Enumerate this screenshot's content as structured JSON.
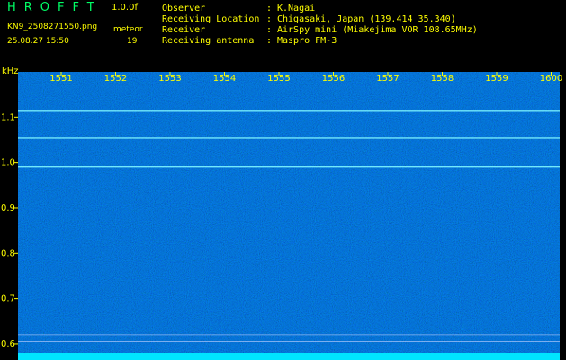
{
  "header": {
    "app_title": "HROFFT",
    "version": "1.0.0f",
    "filename": "KN9_2508271550.png",
    "datetime": "25.08.27 15:50",
    "meteor_label": "meteor",
    "meteor_count": "19"
  },
  "metadata": [
    {
      "key": "Observer",
      "value": "K.Nagai"
    },
    {
      "key": "Receiving Location",
      "value": "Chigasaki, Japan (139.414 35.340)"
    },
    {
      "key": "Receiver",
      "value": "AirSpy mini (Miakejima VOR 108.65MHz)"
    },
    {
      "key": "Receiving antenna",
      "value": "Maspro FM-3"
    }
  ],
  "colors": {
    "background": "#000000",
    "text": "#ffff00",
    "title": "#00ff66",
    "noise": "#1a2aa8",
    "band": "#00e5ff"
  },
  "chart_data": {
    "type": "heatmap",
    "title": "",
    "xlabel": "",
    "ylabel": "kHz",
    "x_ticks": [
      "1551",
      "1552",
      "1553",
      "1554",
      "1555",
      "1556",
      "1557",
      "1558",
      "1559",
      "1600"
    ],
    "y_ticks": [
      "1.1",
      "1.0",
      "0.9",
      "0.8",
      "0.7",
      "0.6"
    ],
    "ylim": [
      0.58,
      1.2
    ],
    "horizontal_lines_khz": [
      1.115,
      1.055,
      0.99,
      0.62,
      0.605
    ]
  }
}
